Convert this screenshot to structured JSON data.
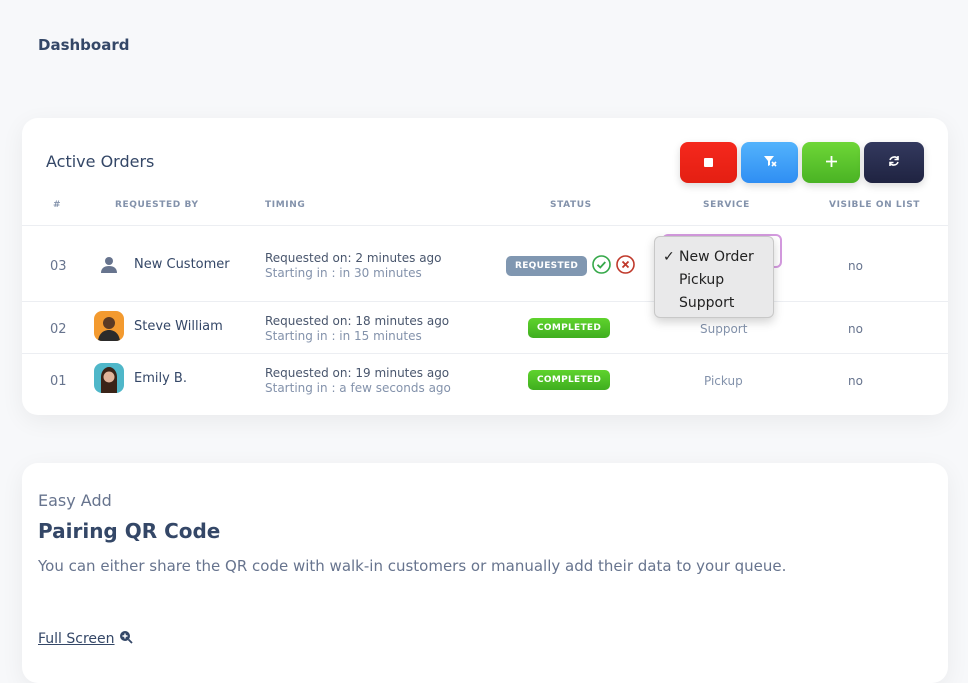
{
  "page": {
    "title": "Dashboard"
  },
  "orders": {
    "title": "Active Orders",
    "toolbar": [
      {
        "name": "stop",
        "icon": "stop-icon",
        "color": "#f5281d"
      },
      {
        "name": "filter",
        "icon": "filter-clear-icon",
        "color": "#53b3fc"
      },
      {
        "name": "add",
        "icon": "plus-icon",
        "color": "#6ed637"
      },
      {
        "name": "refresh",
        "icon": "refresh-icon",
        "color": "#33395e"
      }
    ],
    "columns": [
      "#",
      "REQUESTED BY",
      "TIMING",
      "STATUS",
      "SERVICE",
      "VISIBLE ON LIST"
    ],
    "rows": [
      {
        "num": "03",
        "name": "New Customer",
        "avatar": "person-icon",
        "requested": "Requested on: 2 minutes ago",
        "starting": "Starting in : in 30 minutes",
        "status": "REQUESTED",
        "service": "New Order",
        "visible": "no"
      },
      {
        "num": "02",
        "name": "Steve William",
        "avatar": "avatar-photo",
        "requested": "Requested on: 18 minutes ago",
        "starting": "Starting in : in 15 minutes",
        "status": "COMPLETED",
        "service": "Support",
        "visible": "no"
      },
      {
        "num": "01",
        "name": "Emily B.",
        "avatar": "avatar-photo",
        "requested": "Requested on: 19 minutes ago",
        "starting": "Starting in : a few seconds ago",
        "status": "COMPLETED",
        "service": "Pickup",
        "visible": "no"
      }
    ],
    "service_dropdown": {
      "selected": "New Order",
      "options": [
        "New Order",
        "Pickup",
        "Support"
      ]
    }
  },
  "qr": {
    "eyebrow": "Easy Add",
    "title": "Pairing QR Code",
    "description": "You can either share the QR code with walk-in customers or manually add their data to your queue.",
    "fullscreen_label": "Full Screen"
  }
}
